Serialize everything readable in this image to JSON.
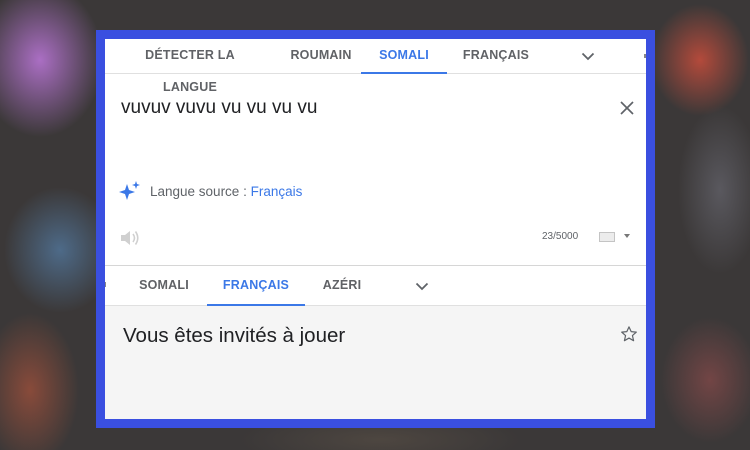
{
  "source_tabs": [
    {
      "label": "DÉTECTER LA LANGUE"
    },
    {
      "label": "ROUMAIN"
    },
    {
      "label": "SOMALI"
    },
    {
      "label": "FRANÇAIS"
    }
  ],
  "source": {
    "text": "vuvuv vuvu vu vu vu vu",
    "lang_hint_prefix": "Langue source : ",
    "lang_hint_link": "Français",
    "char_count": "23/5000"
  },
  "target_tabs": [
    {
      "label": "SOMALI"
    },
    {
      "label": "FRANÇAIS"
    },
    {
      "label": "AZÉRI"
    }
  ],
  "target": {
    "translation": "Vous êtes invités à jouer"
  },
  "icons": {
    "more_languages": "chevron-down-icon",
    "clear": "close-icon",
    "suggestion": "sparkle-icon",
    "listen": "speaker-icon",
    "keyboard": "keyboard-icon",
    "favorite": "star-outline-icon"
  },
  "colors": {
    "accent": "#3b78e7",
    "frame": "#3a4fe0",
    "tab_text": "#606266"
  }
}
